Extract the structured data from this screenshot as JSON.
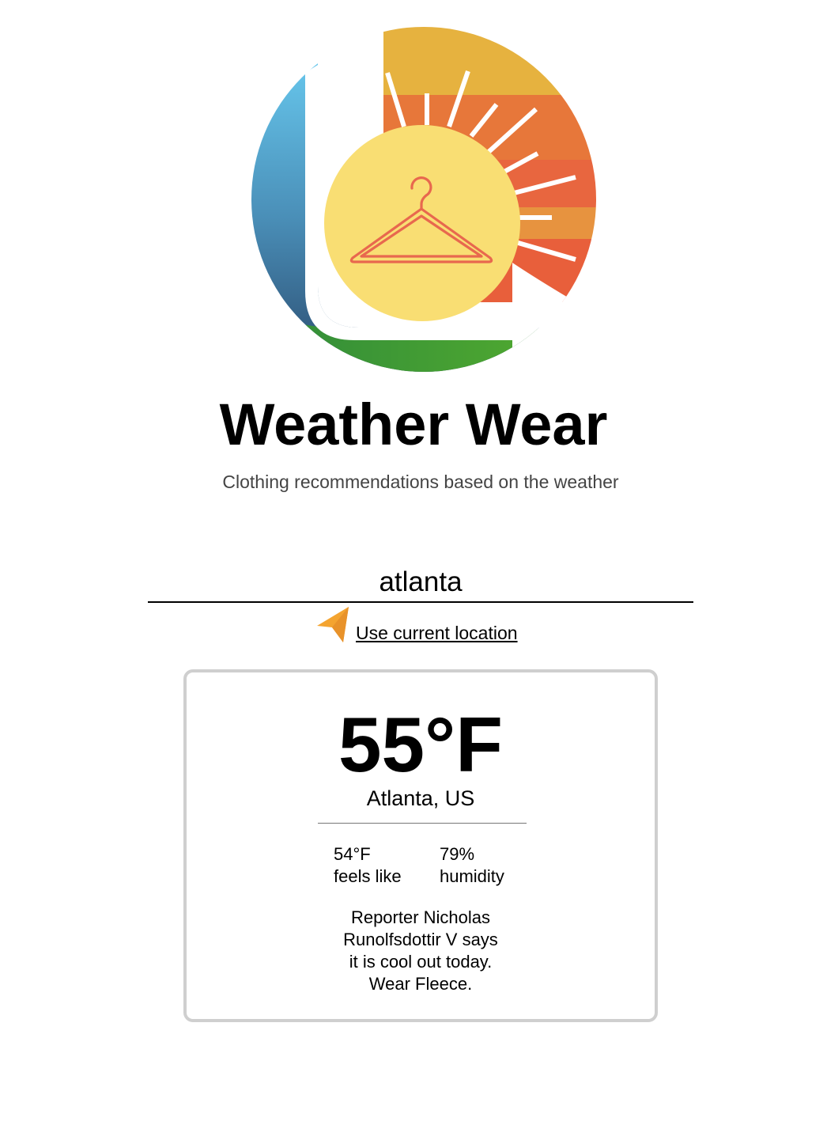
{
  "header": {
    "logo": {
      "icon": "hanger-sun-logo",
      "colors": {
        "sky_top": "#6dd0f6",
        "sky_bottom": "#2c4f74",
        "sun": "#f9de73",
        "hanger": "#e8684e",
        "sunset_top": "#e4b040",
        "sunset_bottom": "#e8623f",
        "grass": "#3c9a35"
      }
    },
    "title": "Weather Wear",
    "subtitle": "Clothing recommendations based on the weather"
  },
  "search": {
    "value": "atlanta",
    "current_location_label": "Use current location",
    "current_location_icon": "navigation-arrow-icon",
    "accent_color": "#f4a430"
  },
  "weather": {
    "temperature": "55°F",
    "location": "Atlanta, US",
    "feels_like_value": "54°F",
    "feels_like_label": "feels like",
    "humidity_value": "79%",
    "humidity_label": "humidity",
    "recommendation_lines": [
      "Reporter Nicholas",
      "Runolfsdottir V says",
      "it is cool out today.",
      "Wear Fleece."
    ]
  }
}
